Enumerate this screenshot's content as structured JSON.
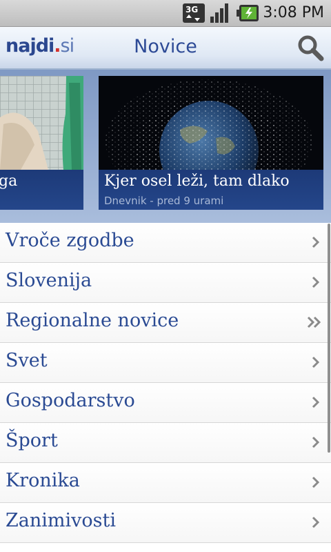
{
  "status_bar": {
    "network": "3G",
    "time": "3:08 PM",
    "icons": [
      "3g-data-icon",
      "signal-icon",
      "battery-charging-icon"
    ]
  },
  "header": {
    "logo_main": "najdi",
    "logo_dot": ".",
    "logo_suffix": "si",
    "title": "Novice",
    "search_icon": "search-icon"
  },
  "carousel": {
    "cards": [
      {
        "headline": "ga",
        "source": ""
      },
      {
        "headline": "Kjer osel leži, tam dlako",
        "source": "Dnevnik - pred 9 urami"
      }
    ]
  },
  "categories": [
    {
      "label": "Vroče zgodbe",
      "icon": "chevron-right-icon"
    },
    {
      "label": "Slovenija",
      "icon": "chevron-right-icon"
    },
    {
      "label": "Regionalne novice",
      "icon": "double-chevron-right-icon"
    },
    {
      "label": "Svet",
      "icon": "chevron-right-icon"
    },
    {
      "label": "Gospodarstvo",
      "icon": "chevron-right-icon"
    },
    {
      "label": "Šport",
      "icon": "chevron-right-icon"
    },
    {
      "label": "Kronika",
      "icon": "chevron-right-icon"
    },
    {
      "label": "Zanimivosti",
      "icon": "chevron-right-icon"
    }
  ],
  "colors": {
    "accent": "#2a4a93",
    "caption_bg": "#1d3a78",
    "logo_dot": "#d4312c"
  }
}
